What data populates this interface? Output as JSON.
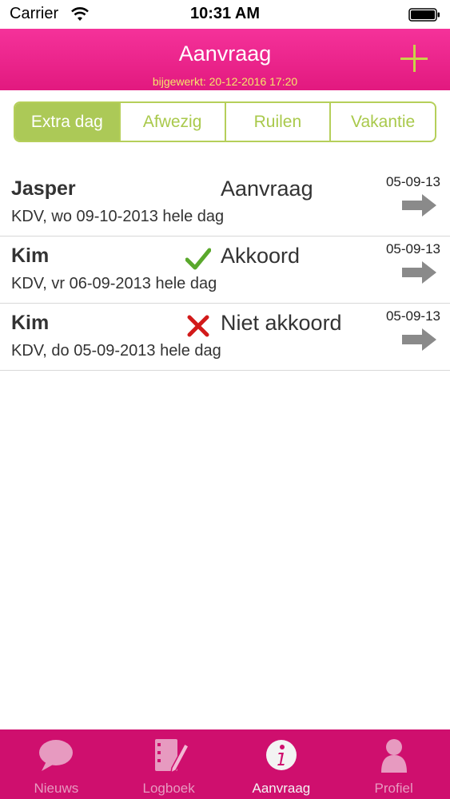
{
  "status_bar": {
    "carrier": "Carrier",
    "time": "10:31 AM"
  },
  "header": {
    "title": "Aanvraag",
    "updated": "bijgewerkt: 20-12-2016 17:20"
  },
  "segments": [
    {
      "label": "Extra dag",
      "active": true
    },
    {
      "label": "Afwezig",
      "active": false
    },
    {
      "label": "Ruilen",
      "active": false
    },
    {
      "label": "Vakantie",
      "active": false
    }
  ],
  "requests": [
    {
      "name": "Jasper",
      "status": "Aanvraag",
      "status_icon": "none",
      "details": "KDV, wo 09-10-2013 hele dag",
      "date": "05-09-13"
    },
    {
      "name": "Kim",
      "status": "Akkoord",
      "status_icon": "check-icon",
      "details": "KDV, vr 06-09-2013 hele dag",
      "date": "05-09-13"
    },
    {
      "name": "Kim",
      "status": "Niet akkoord",
      "status_icon": "cross-icon",
      "details": "KDV, do 05-09-2013 hele dag",
      "date": "05-09-13"
    }
  ],
  "tabs": [
    {
      "label": "Nieuws",
      "icon": "speech-bubble-icon",
      "active": false
    },
    {
      "label": "Logboek",
      "icon": "notebook-pencil-icon",
      "active": false
    },
    {
      "label": "Aanvraag",
      "icon": "info-icon",
      "active": true
    },
    {
      "label": "Profiel",
      "icon": "person-icon",
      "active": false
    }
  ],
  "colors": {
    "brand_pink": "#e2197f",
    "accent_green": "#acc957",
    "tab_bar": "#cf0f6e",
    "approved": "#5aa82c",
    "rejected": "#d21a1a"
  }
}
